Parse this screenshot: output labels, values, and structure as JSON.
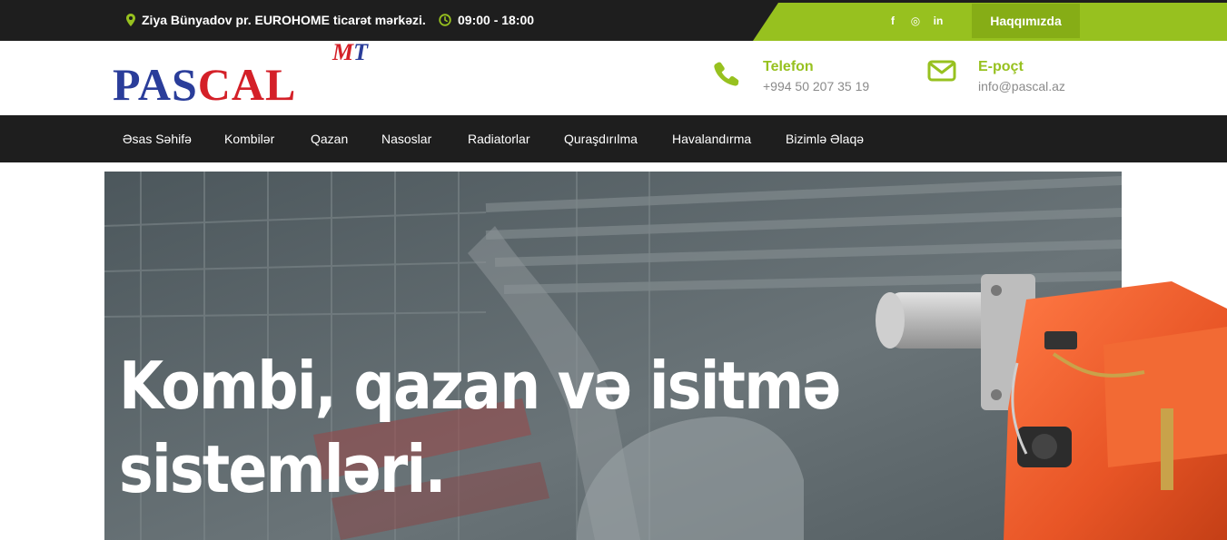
{
  "topbar": {
    "address": "Ziya Bünyadov pr. EUROHOME ticarət mərkəzi.",
    "hours": "09:00 - 18:00",
    "socials": [
      {
        "icon": "facebook-icon",
        "glyph": "f"
      },
      {
        "icon": "instagram-icon",
        "glyph": "◎"
      },
      {
        "icon": "linkedin-icon",
        "glyph": "in"
      }
    ],
    "about_label": "Haqqımızda"
  },
  "header": {
    "logo": {
      "part1": "PAS",
      "part2": "CAL",
      "mark1": "M",
      "mark2": "T"
    },
    "phone": {
      "title": "Telefon",
      "value": "+994 50 207 35 19"
    },
    "email": {
      "title": "E-poçt",
      "value": "info@pascal.az"
    }
  },
  "nav": {
    "items": [
      "Əsas Səhifə",
      "Kombilər",
      "Qazan",
      "Nasoslar",
      "Radiatorlar",
      "Quraşdırılma",
      "Havalandırma",
      "Bizimlə Əlaqə"
    ]
  },
  "hero": {
    "line1": "Kombi, qazan və isitmə",
    "line2": "sistemləri."
  },
  "colors": {
    "accent": "#97c11f",
    "dark": "#1e1e1e",
    "logo_blue": "#2a3d9a",
    "logo_red": "#d42028"
  }
}
